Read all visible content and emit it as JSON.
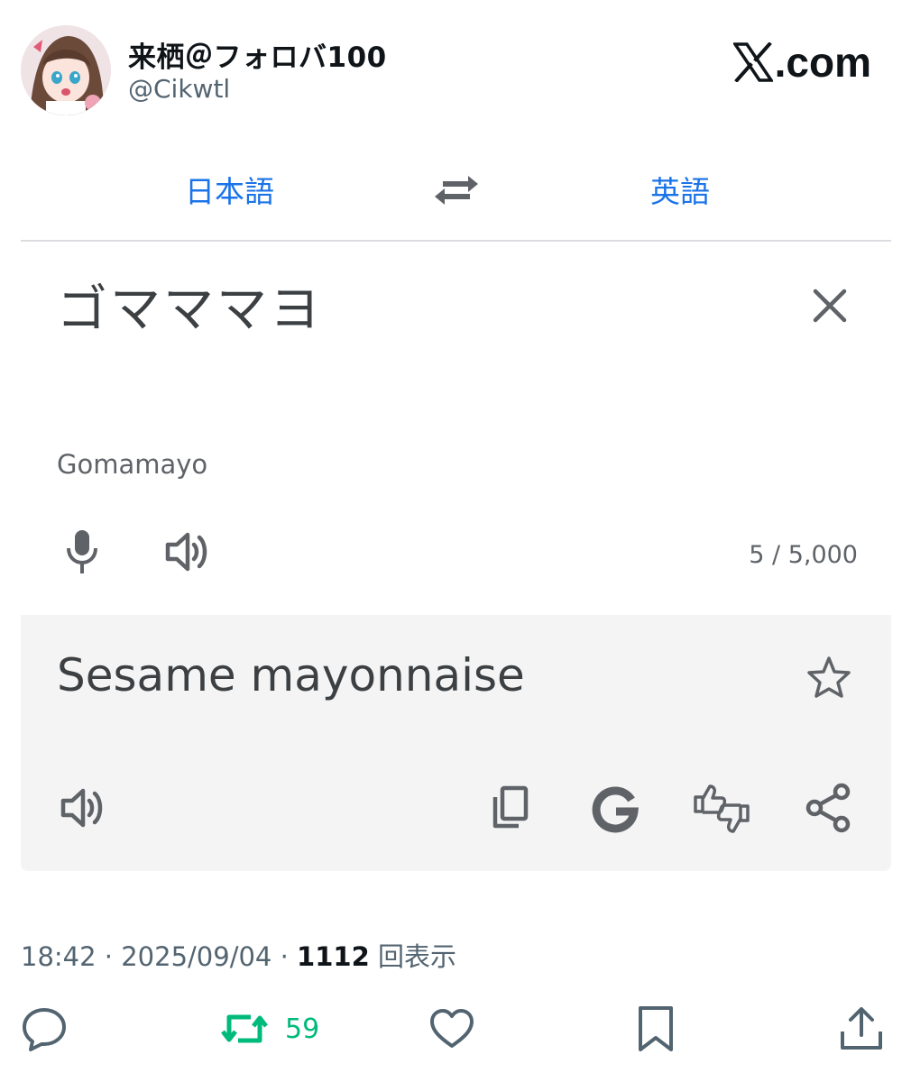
{
  "tweet": {
    "display_name": "来栖＠フォロバ100",
    "handle": "@Cikwtl",
    "brand": ".com",
    "timestamp": "18:42 · 2025/09/04 · ",
    "views_count": "1112",
    "views_label": " 回表示",
    "retweet_count": "59"
  },
  "translate": {
    "source_lang": "日本語",
    "target_lang": "英語",
    "source_text": "ゴマママヨ",
    "romanization": "Gomamayo",
    "char_count": "5 / 5,000",
    "target_text": "Sesame mayonnaise"
  },
  "colors": {
    "link_blue": "#1a73e8",
    "retweet_green": "#00ba7c",
    "icon_gray": "#5f6368",
    "result_bg": "#f4f4f4"
  },
  "icons": [
    "swap-icon",
    "close-icon",
    "microphone-icon",
    "speaker-icon",
    "star-icon",
    "copy-icon",
    "google-icon",
    "feedback-icon",
    "share-icon",
    "reply-icon",
    "retweet-icon",
    "like-icon",
    "bookmark-icon",
    "upload-icon",
    "x-logo-icon"
  ]
}
